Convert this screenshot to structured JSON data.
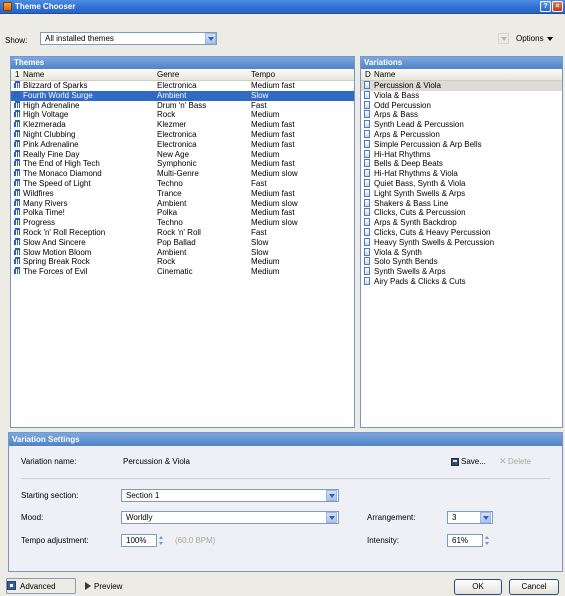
{
  "window": {
    "title": "Theme Chooser"
  },
  "toolbar": {
    "show_label": "Show:",
    "show_value": "All installed themes",
    "options_label": "Options"
  },
  "themes": {
    "header": "Themes",
    "columns": {
      "number": "1",
      "name": "Name",
      "genre": "Genre",
      "tempo": "Tempo"
    },
    "rows": [
      {
        "name": "Blizzard of Sparks",
        "genre": "Electronica",
        "tempo": "Medium fast"
      },
      {
        "name": "Fourth World Surge",
        "genre": "Ambient",
        "tempo": "Slow"
      },
      {
        "name": "High Adrenaline",
        "genre": "Drum 'n' Bass",
        "tempo": "Fast"
      },
      {
        "name": "High Voltage",
        "genre": "Rock",
        "tempo": "Medium"
      },
      {
        "name": "Klezmerada",
        "genre": "Klezmer",
        "tempo": "Medium fast"
      },
      {
        "name": "Night Clubbing",
        "genre": "Electronica",
        "tempo": "Medium fast"
      },
      {
        "name": "Pink Adrenaline",
        "genre": "Electronica",
        "tempo": "Medium fast"
      },
      {
        "name": "Really Fine Day",
        "genre": "New Age",
        "tempo": "Medium"
      },
      {
        "name": "The End of High Tech",
        "genre": "Symphonic",
        "tempo": "Medium fast"
      },
      {
        "name": "The Monaco Diamond",
        "genre": "Multi-Genre",
        "tempo": "Medium slow"
      },
      {
        "name": "The Speed of Light",
        "genre": "Techno",
        "tempo": "Fast"
      },
      {
        "name": "Wildfires",
        "genre": "Trance",
        "tempo": "Medium fast"
      },
      {
        "name": "Many Rivers",
        "genre": "Ambient",
        "tempo": "Medium slow"
      },
      {
        "name": "Polka Time!",
        "genre": "Polka",
        "tempo": "Medium fast"
      },
      {
        "name": "Progress",
        "genre": "Techno",
        "tempo": "Medium slow"
      },
      {
        "name": "Rock 'n' Roll Reception",
        "genre": "Rock 'n' Roll",
        "tempo": "Fast"
      },
      {
        "name": "Slow And Sincere",
        "genre": "Pop Ballad",
        "tempo": "Slow"
      },
      {
        "name": "Slow Motion Bloom",
        "genre": "Ambient",
        "tempo": "Slow"
      },
      {
        "name": "Spring Break Rock",
        "genre": "Rock",
        "tempo": "Medium"
      },
      {
        "name": "The Forces of Evil",
        "genre": "Cinematic",
        "tempo": "Medium"
      }
    ]
  },
  "variations": {
    "header": "Variations",
    "columns": {
      "icon": "D",
      "name": "Name"
    },
    "rows": [
      "Percussion & Viola",
      "Viola & Bass",
      "Odd Percussion",
      "Arps & Bass",
      "Synth Lead & Percussion",
      "Arps & Percussion",
      "Simple Percussion & Arp Bells",
      "Hi-Hat Rhythms",
      "Bells & Deep Beats",
      "Hi-Hat Rhythms & Viola",
      "Quiet Bass, Synth & Viola",
      "Light Synth Swells & Arps",
      "Shakers & Bass Line",
      "Clicks, Cuts & Percussion",
      "Arps & Synth Backdrop",
      "Clicks, Cuts & Heavy Percussion",
      "Heavy Synth Swells & Percussion",
      "Viola & Synth",
      "Solo Synth Bends",
      "Synth Swells & Arps",
      "Airy Pads & Clicks & Cuts"
    ]
  },
  "settings": {
    "header": "Variation Settings",
    "variation_name_label": "Variation name:",
    "variation_name_value": "Percussion & Viola",
    "save_label": "Save...",
    "delete_label": "Delete",
    "starting_section_label": "Starting section:",
    "starting_section_value": "Section 1",
    "mood_label": "Mood:",
    "mood_value": "Worldly",
    "arrangement_label": "Arrangement:",
    "arrangement_value": "3",
    "tempo_label": "Tempo adjustment:",
    "tempo_value": "100%",
    "tempo_bpm": "(60.0 BPM)",
    "intensity_label": "Intensity:",
    "intensity_value": "61%"
  },
  "footer": {
    "advanced_label": "Advanced",
    "preview_label": "Preview",
    "ok_label": "OK",
    "cancel_label": "Cancel"
  }
}
